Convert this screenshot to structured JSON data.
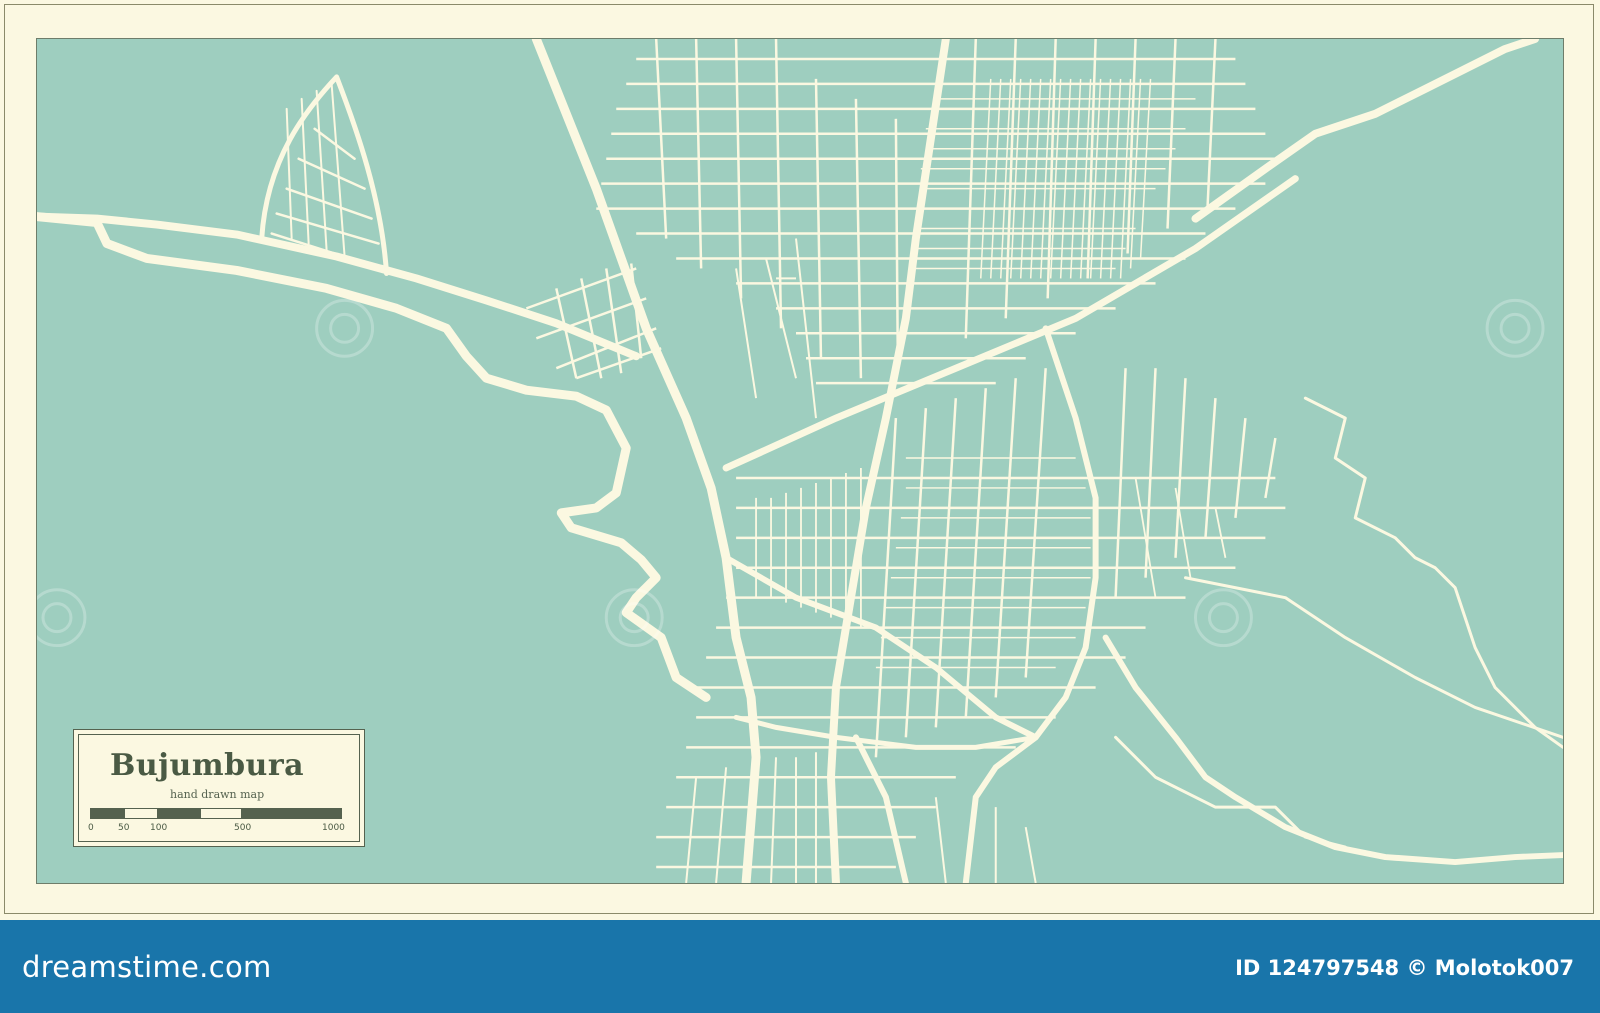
{
  "map": {
    "title": "Bujumbura",
    "subtitle": "hand drawn map",
    "water_color": "#9ecebf",
    "land_color": "#9ecebf",
    "road_color": "#fbf8e1",
    "frame_color": "#fbf8e1"
  },
  "scale": {
    "labels": [
      "0",
      "50",
      "100",
      "500",
      "1000"
    ]
  },
  "footer": {
    "brand": "dreamstime.com",
    "id_text": "ID 124797548 © Molotok007",
    "background": "#1975aa"
  }
}
